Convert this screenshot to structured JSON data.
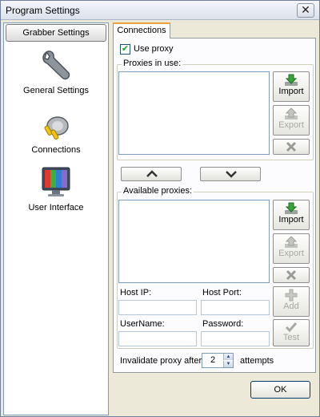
{
  "window": {
    "title": "Program Settings",
    "close_glyph": "✕"
  },
  "sidebar": {
    "header": "Grabber Settings",
    "items": [
      {
        "label": "General Settings",
        "icon": "wrench-icon"
      },
      {
        "label": "Connections",
        "icon": "plug-icon"
      },
      {
        "label": "User Interface",
        "icon": "monitor-icon"
      }
    ]
  },
  "tabs": [
    {
      "label": "Connections",
      "active": true
    }
  ],
  "connections": {
    "use_proxy": {
      "label": "Use proxy",
      "checked": true
    },
    "proxies_in_use": {
      "label": "Proxies in use:",
      "items": []
    },
    "available_proxies": {
      "label": "Available proxies:",
      "items": []
    },
    "buttons": {
      "import": "Import",
      "export": "Export",
      "add": "Add",
      "test": "Test"
    },
    "host_ip": {
      "label": "Host IP:",
      "value": ""
    },
    "host_port": {
      "label": "Host Port:",
      "value": ""
    },
    "username": {
      "label": "UserName:",
      "value": ""
    },
    "password": {
      "label": "Password:",
      "value": ""
    },
    "invalidate": {
      "prefix": "Invalidate proxy after",
      "value": "2",
      "suffix": "attempts"
    }
  },
  "footer": {
    "ok_label": "OK"
  },
  "colors": {
    "accent_tab": "#e9a33a",
    "import_arrow": "#3aa33a",
    "remove_x": "#666666"
  }
}
